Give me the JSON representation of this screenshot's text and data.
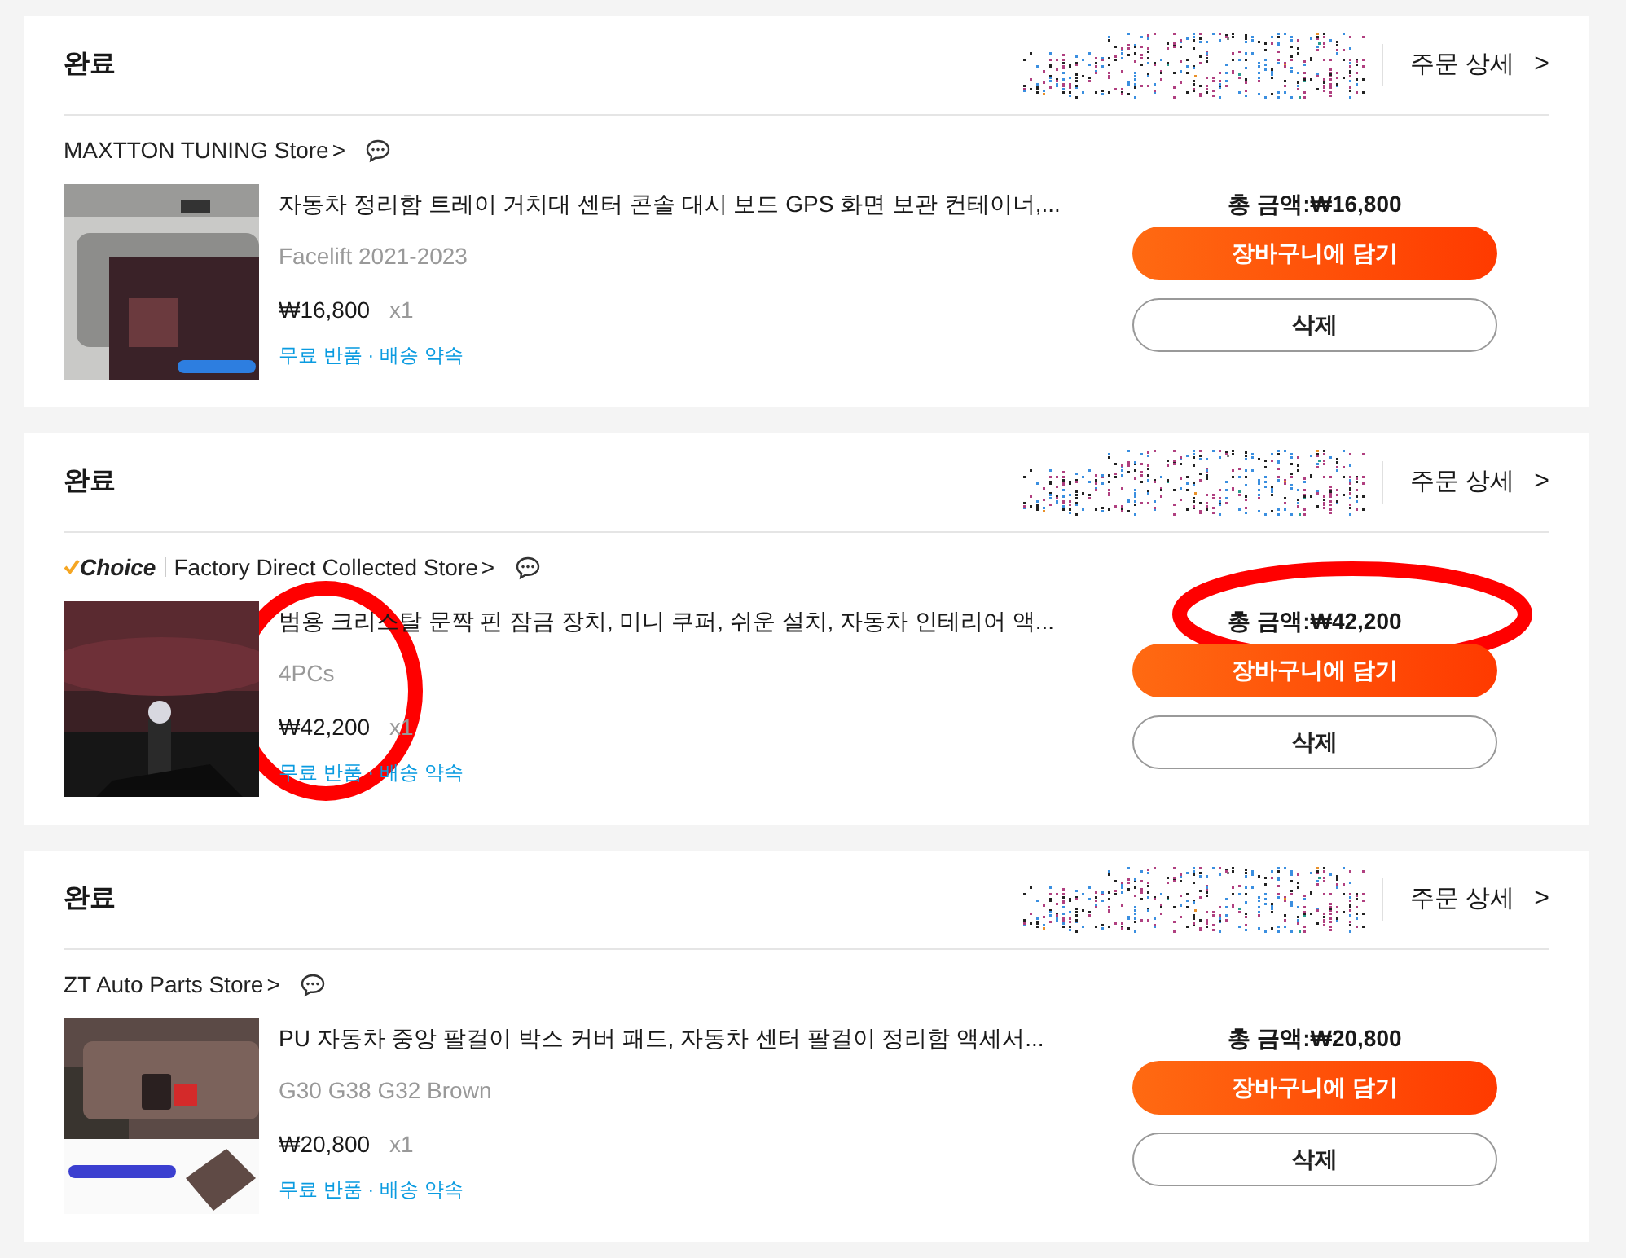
{
  "orders": [
    {
      "status": "완료",
      "detail_link": "주문 상세",
      "chevron": ">",
      "store": {
        "name": "MAXTTON TUNING Store",
        "arrow": ">"
      },
      "item": {
        "title": "자동차 정리함 트레이 거치대 센터 콘솔 대시 보드 GPS 화면 보관 컨테이너,...",
        "variant": "Facelift 2021-2023",
        "price": "₩16,800",
        "quantity": "x1",
        "service": "무료 반품 · 배송 약속"
      },
      "total": "총 금액:₩16,800",
      "cart_button": "장바구니에 담기",
      "delete_button": "삭제"
    },
    {
      "status": "완료",
      "detail_link": "주문 상세",
      "chevron": ">",
      "store": {
        "choice": "Choice",
        "name": "Factory Direct Collected Store",
        "arrow": ">"
      },
      "item": {
        "title": "범용 크리스탈 문짝 핀 잠금 장치, 미니 쿠퍼, 쉬운 설치, 자동차 인테리어 액...",
        "variant": "4PCs",
        "price": "₩42,200",
        "quantity": "x1",
        "service": "무료 반품 · 배송 약속"
      },
      "total": "총 금액:₩42,200",
      "cart_button": "장바구니에 담기",
      "delete_button": "삭제"
    },
    {
      "status": "완료",
      "detail_link": "주문 상세",
      "chevron": ">",
      "store": {
        "name": "ZT Auto Parts Store",
        "arrow": ">"
      },
      "item": {
        "title": "PU 자동차 중앙 팔걸이 박스 커버 패드, 자동차 센터 팔걸이 정리함 액세서...",
        "variant": "G30 G38 G32 Brown",
        "price": "₩20,800",
        "quantity": "x1",
        "service": "무료 반품 · 배송 약속"
      },
      "total": "총 금액:₩20,800",
      "cart_button": "장바구니에 담기",
      "delete_button": "삭제"
    }
  ],
  "annotations": [
    {
      "kind": "ellipse",
      "color": "#ff0000"
    },
    {
      "kind": "ellipse",
      "color": "#ff0000"
    }
  ]
}
